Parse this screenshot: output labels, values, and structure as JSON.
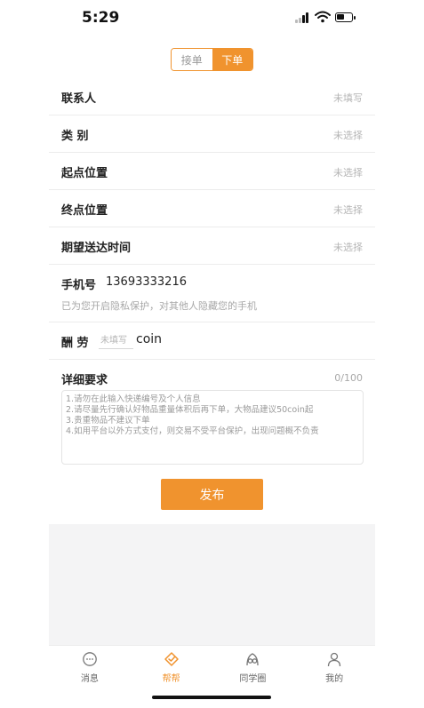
{
  "status_bar": {
    "time": "5:29",
    "battery_level": 0.55
  },
  "segmented": {
    "options": [
      "接单",
      "下单"
    ],
    "selected": "下单"
  },
  "form": {
    "contact": {
      "label": "联系人",
      "value": "未填写"
    },
    "category": {
      "label": "类 别",
      "value": "未选择"
    },
    "start": {
      "label": "起点位置",
      "value": "未选择"
    },
    "end": {
      "label": "终点位置",
      "value": "未选择"
    },
    "expected_time": {
      "label": "期望送达时间",
      "value": "未选择"
    },
    "phone": {
      "label": "手机号",
      "number": "13693333216",
      "hint": "已为您开启隐私保护，对其他人隐藏您的手机"
    },
    "reward": {
      "label": "酬 劳",
      "placeholder": "未填写",
      "value": "",
      "unit": "coin"
    },
    "detail": {
      "label": "详细要求",
      "count": "0/100",
      "placeholder": "1.请勿在此输入快递编号及个人信息\n2.请尽量先行确认好物品重量体积后再下单，大物品建议50coin起\n3.贵重物品不建议下单\n4.如用平台以外方式支付，则交易不受平台保护，出现问题概不负责"
    }
  },
  "submit_label": "发布",
  "tabbar": {
    "items": [
      {
        "label": "消息",
        "icon": "message-icon"
      },
      {
        "label": "帮帮",
        "icon": "helper-icon",
        "active": true
      },
      {
        "label": "同学圈",
        "icon": "classmates-icon"
      },
      {
        "label": "我的",
        "icon": "profile-icon"
      }
    ]
  },
  "colors": {
    "accent": "#f0932e",
    "muted": "#b5b5b5",
    "divider": "#ececec",
    "gray_bg": "#f4f4f5"
  }
}
